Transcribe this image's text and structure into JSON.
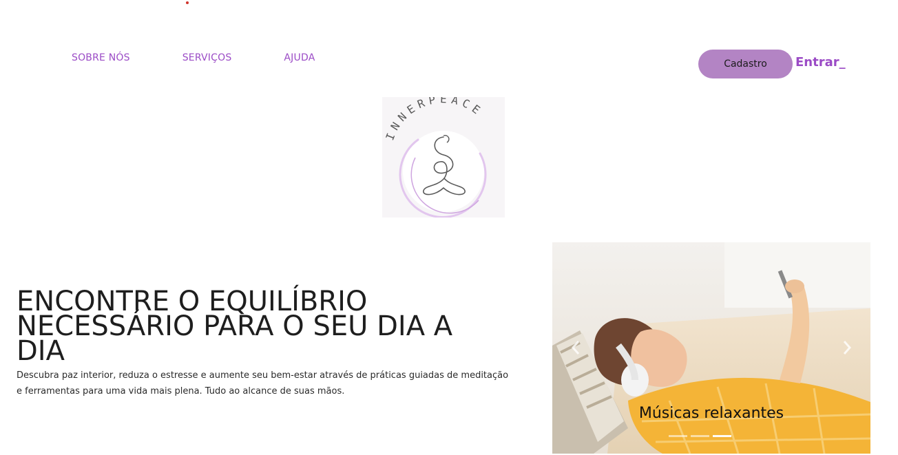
{
  "nav": {
    "items": [
      {
        "label": "SOBRE NÓS"
      },
      {
        "label": "SERVIÇOS"
      },
      {
        "label": "AJUDA"
      }
    ]
  },
  "auth": {
    "signup_label": "Cadastro",
    "login_label": "Entrar_"
  },
  "logo": {
    "text": "INNERPEACE"
  },
  "hero": {
    "title": "ENCONTRE O EQUILÍBRIO NECESSÁRIO PARA O SEU DIA A DIA",
    "description": "Descubra paz interior, reduza o estresse e aumente seu bem-estar através de práticas guiadas de meditação e ferramentas para uma vida mais plena. Tudo ao alcance de suas mãos."
  },
  "carousel": {
    "caption": "Músicas relaxantes",
    "slide_count": 3,
    "active_index": 2
  },
  "colors": {
    "accent": "#9b4bc6",
    "button_bg": "#b384c4",
    "dot": "#d0342c"
  }
}
